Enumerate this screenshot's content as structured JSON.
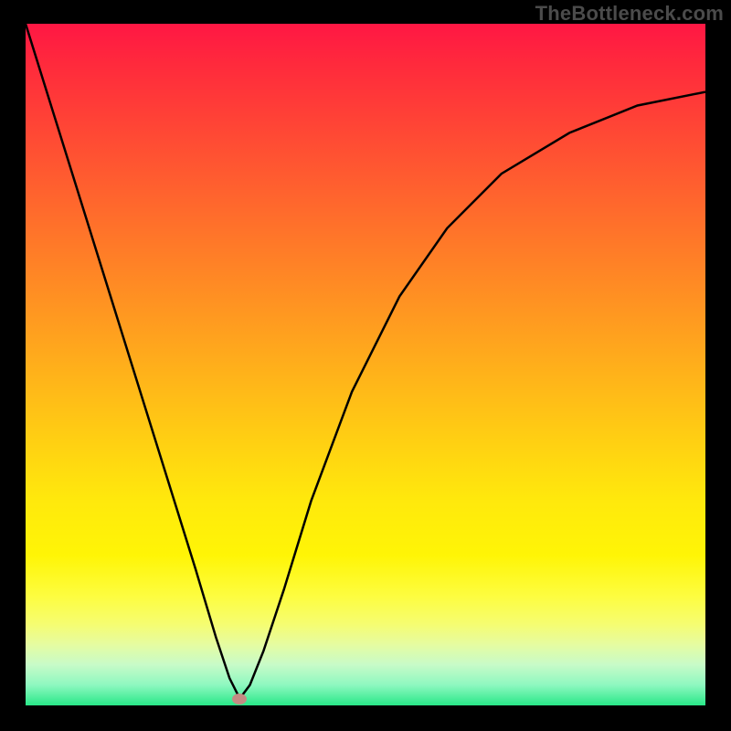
{
  "watermark": "TheBottleneck.com",
  "chart_data": {
    "type": "line",
    "title": "",
    "xlabel": "",
    "ylabel": "",
    "xlim": [
      0,
      100
    ],
    "ylim": [
      0,
      100
    ],
    "grid": false,
    "legend": false,
    "series": [
      {
        "name": "bottleneck-curve",
        "x": [
          0,
          5,
          10,
          15,
          20,
          25,
          28,
          30,
          31.5,
          33,
          35,
          38,
          42,
          48,
          55,
          62,
          70,
          80,
          90,
          100
        ],
        "y": [
          100,
          84,
          68,
          52,
          36,
          20,
          10,
          4,
          1,
          3,
          8,
          17,
          30,
          46,
          60,
          70,
          78,
          84,
          88,
          90
        ]
      }
    ],
    "marker": {
      "x": 31.5,
      "y": 1,
      "name": "optimal-point"
    },
    "background_gradient": {
      "orientation": "vertical",
      "stops": [
        {
          "pos": 0.0,
          "color": "#ff1744"
        },
        {
          "pos": 0.3,
          "color": "#ff722a"
        },
        {
          "pos": 0.62,
          "color": "#ffd212"
        },
        {
          "pos": 0.84,
          "color": "#fdfd40"
        },
        {
          "pos": 1.0,
          "color": "#29e888"
        }
      ]
    }
  }
}
